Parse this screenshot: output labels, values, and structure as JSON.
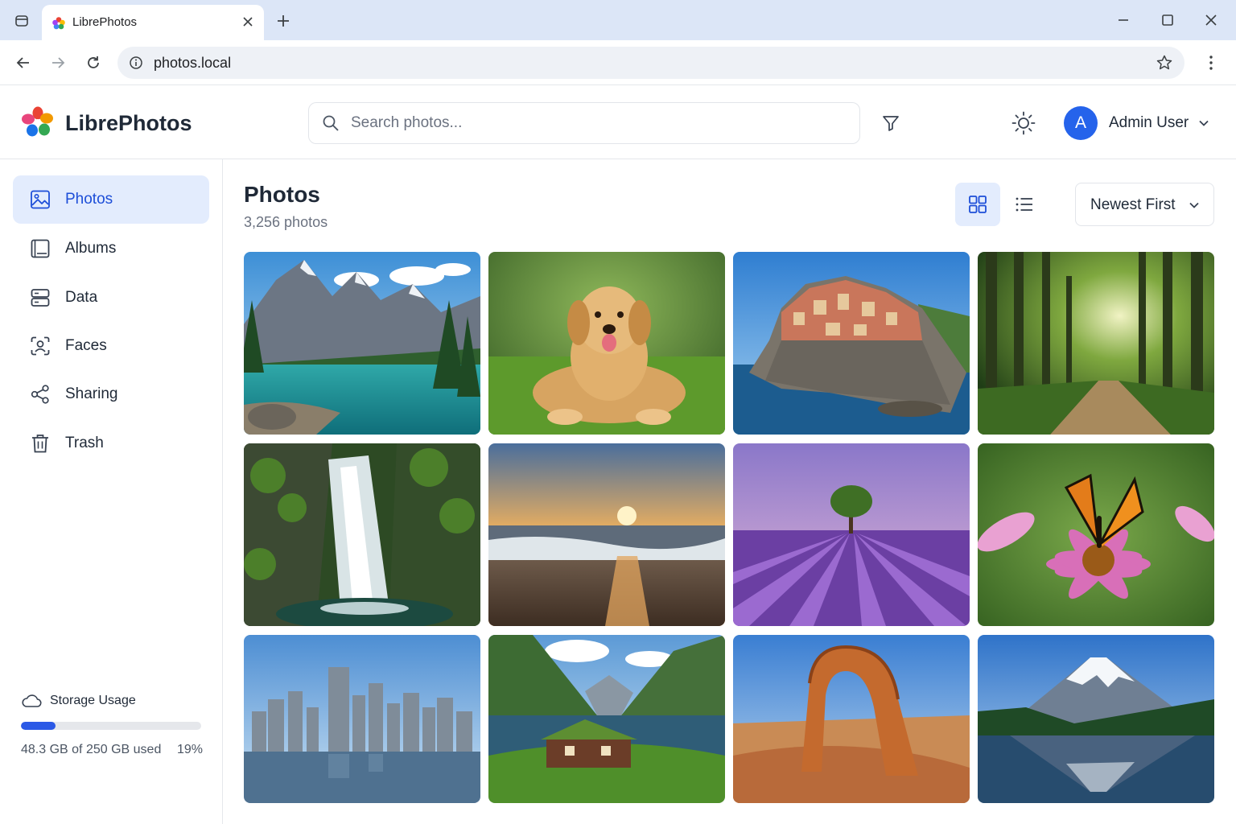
{
  "browser": {
    "tab_title": "LibrePhotos",
    "url": "photos.local"
  },
  "app": {
    "brand": "LibrePhotos",
    "search_placeholder": "Search photos...",
    "user": {
      "initial": "A",
      "name": "Admin User"
    }
  },
  "sidebar": {
    "items": [
      {
        "label": "Photos",
        "icon": "image-icon",
        "active": true
      },
      {
        "label": "Albums",
        "icon": "album-icon",
        "active": false
      },
      {
        "label": "Data",
        "icon": "server-icon",
        "active": false
      },
      {
        "label": "Faces",
        "icon": "face-scan-icon",
        "active": false
      },
      {
        "label": "Sharing",
        "icon": "share-icon",
        "active": false
      },
      {
        "label": "Trash",
        "icon": "trash-icon",
        "active": false
      }
    ],
    "storage": {
      "title": "Storage Usage",
      "used_text": "48.3 GB of 250 GB used",
      "percent_text": "19%",
      "fraction": 0.19
    }
  },
  "main": {
    "title": "Photos",
    "count": "3,256 photos",
    "sort": {
      "selected": "Newest First"
    },
    "view_mode": "grid"
  },
  "photos": [
    {
      "subject": "mountain-lake"
    },
    {
      "subject": "golden-retriever"
    },
    {
      "subject": "cliffside-village"
    },
    {
      "subject": "forest-path"
    },
    {
      "subject": "waterfall"
    },
    {
      "subject": "beach-sunset"
    },
    {
      "subject": "lavender-field-tree"
    },
    {
      "subject": "butterfly-on-flower"
    },
    {
      "subject": "city-skyline"
    },
    {
      "subject": "fjord-cabin"
    },
    {
      "subject": "desert-arch"
    },
    {
      "subject": "snowy-volcano-lake"
    }
  ],
  "colors": {
    "accent": "#2563eb",
    "active_bg": "#e3ecfd",
    "border": "#e5e7eb"
  }
}
